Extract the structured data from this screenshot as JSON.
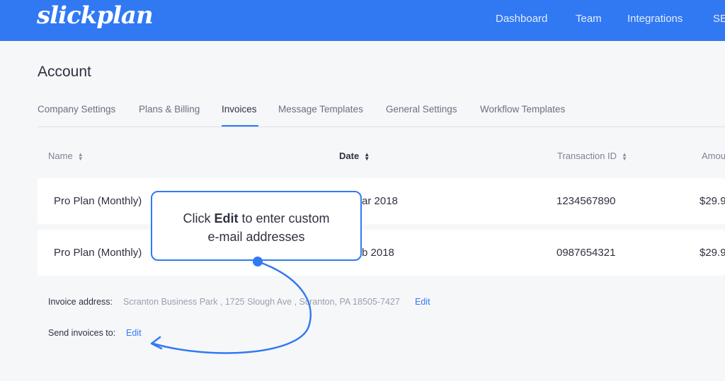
{
  "header": {
    "logo": "slickplan",
    "nav": [
      "Dashboard",
      "Team",
      "Integrations",
      "SE"
    ]
  },
  "page": {
    "title": "Account"
  },
  "tabs": [
    {
      "label": "Company Settings",
      "active": false
    },
    {
      "label": "Plans & Billing",
      "active": false
    },
    {
      "label": "Invoices",
      "active": true
    },
    {
      "label": "Message Templates",
      "active": false
    },
    {
      "label": "General Settings",
      "active": false
    },
    {
      "label": "Workflow Templates",
      "active": false
    }
  ],
  "table": {
    "columns": [
      "Name",
      "Date",
      "Transaction ID",
      "Amou"
    ],
    "rows": [
      {
        "name": "Pro Plan (Monthly)",
        "date": "ar 2018",
        "transaction_id": "1234567890",
        "amount": "$29.9"
      },
      {
        "name": "Pro Plan (Monthly)",
        "date": "b 2018",
        "transaction_id": "0987654321",
        "amount": "$29.9"
      }
    ]
  },
  "invoice_address": {
    "label": "Invoice address:",
    "value": "Scranton Business Park , 1725 Slough Ave , Scranton, PA 18505-7427",
    "edit_label": "Edit"
  },
  "send_invoices": {
    "label": "Send invoices to:",
    "edit_label": "Edit"
  },
  "callout": {
    "prefix": "Click ",
    "bold": "Edit",
    "suffix": " to enter custom",
    "line2": "e-mail addresses"
  },
  "colors": {
    "brand": "#3179f3",
    "background": "#f6f7f9"
  }
}
